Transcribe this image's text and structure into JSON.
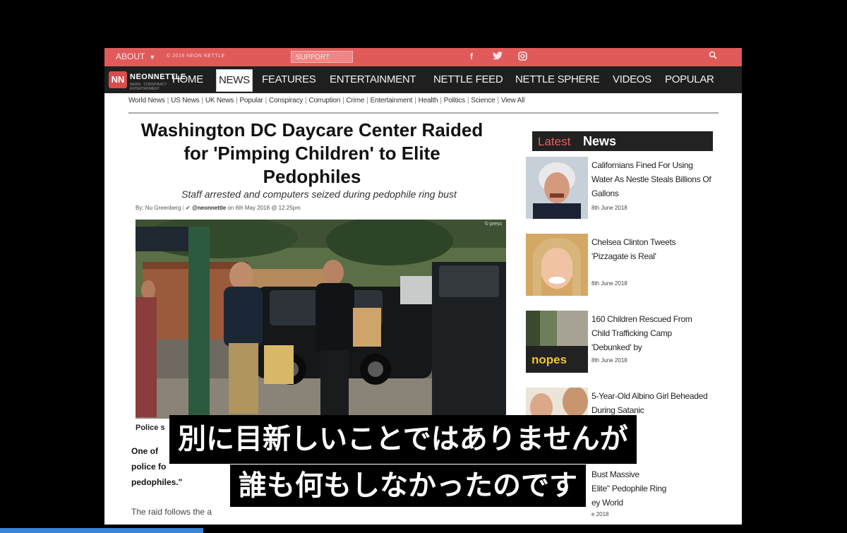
{
  "topbar": {
    "about": "ABOUT",
    "tiny_text": "© 2018 NEON NETTLE",
    "support": "SUPPORT",
    "facebook": "f",
    "twitter": "twitter",
    "instagram": "instagram"
  },
  "logo": {
    "mark": "NN",
    "word": "NEONNETTLE",
    "sub": "NEWS · CONSPIRACY · ENTERTAINMENT"
  },
  "nav": {
    "items": [
      {
        "label": "HOME"
      },
      {
        "label": "NEWS"
      },
      {
        "label": "FEATURES"
      },
      {
        "label": "ENTERTAINMENT"
      },
      {
        "label": "NETTLE FEED"
      },
      {
        "label": "NETTLE SPHERE"
      },
      {
        "label": "VIDEOS"
      },
      {
        "label": "POPULAR"
      }
    ],
    "active": "NEWS"
  },
  "subnav": [
    "World News",
    "US News",
    "UK News",
    "Popular",
    "Conspiracy",
    "Corruption",
    "Crime",
    "Entertainment",
    "Health",
    "Politics",
    "Science",
    "View All"
  ],
  "article": {
    "headline_1": "Washington DC Daycare Center Raided",
    "headline_2": "for 'Pimping Children' to Elite",
    "headline_3": "Pedophiles",
    "standfirst": "Staff arrested and computers seized during pedophile ring bust",
    "by": "By:",
    "author": "Nu Greenberg",
    "handle": "@neonnettle",
    "date": "on 6th May 2018 @ 12.25pm",
    "photo_credit": "© press",
    "caption": "Police s",
    "body_1": "One of",
    "body_2": "police fo",
    "body_3": "pedophiles.\"",
    "body_4": "The raid follows the a",
    "colors": {
      "accent": "#e15a5a",
      "nav": "#1f1f1f"
    }
  },
  "sidebar": {
    "latest_1": "Latest",
    "latest_2": "News",
    "items": [
      {
        "title": "Californians Fined For Using Water As Nestle Steals Billions Of Gallons",
        "date": "8th June 2018"
      },
      {
        "title": "Chelsea Clinton Tweets 'Pizzagate is Real'",
        "date": "8th June 2018"
      },
      {
        "title": "160 Children Rescued From Child Trafficking Camp 'Debunked' by",
        "date": "8th June 2018",
        "thumb_text": "nopes"
      },
      {
        "title": "5-Year-Old Albino Girl Beheaded During Satanic",
        "date": ""
      }
    ],
    "partial_1": "Bust Massive",
    "partial_2": "Elite\" Pedophile Ring",
    "partial_3": "ey World",
    "partial_date": "e 2018"
  },
  "subtitle": {
    "line_1": "別に目新しいことではありませんが",
    "line_2": "誰も何もしなかったのです"
  }
}
